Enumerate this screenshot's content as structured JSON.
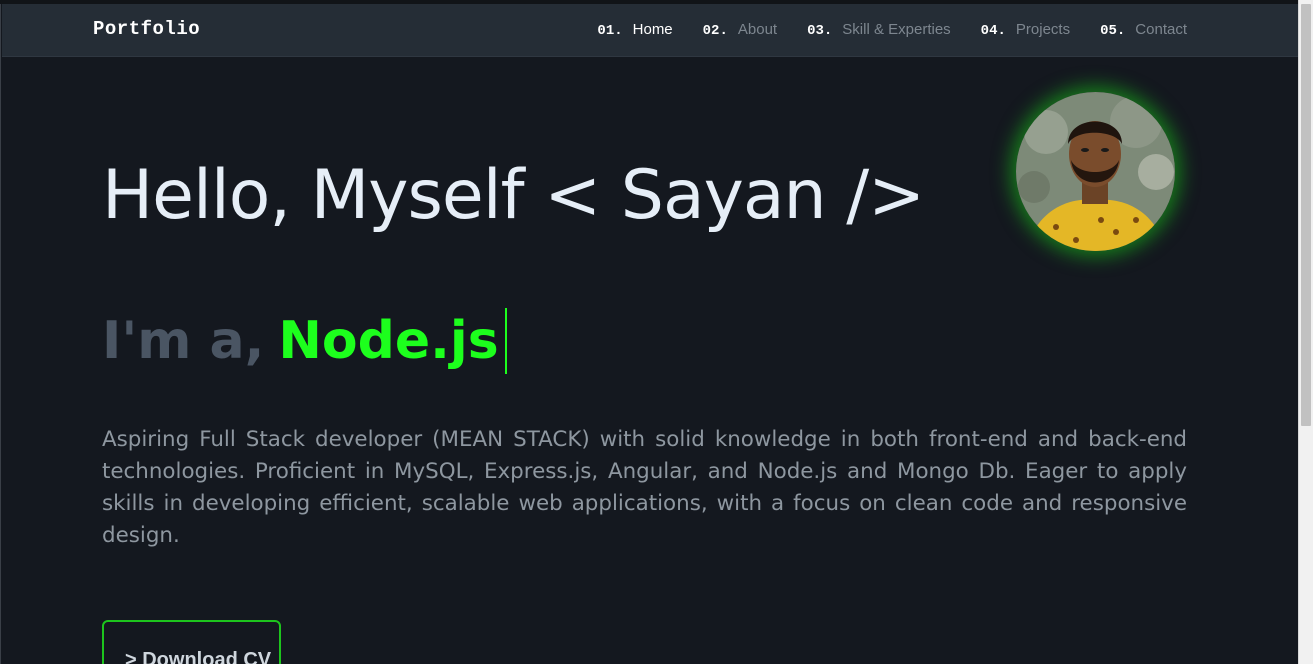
{
  "navbar": {
    "brand": "Portfolio",
    "items": [
      {
        "num": "01.",
        "label": "Home",
        "active": true
      },
      {
        "num": "02.",
        "label": "About",
        "active": false
      },
      {
        "num": "03.",
        "label": "Skill & Experties",
        "active": false
      },
      {
        "num": "04.",
        "label": "Projects",
        "active": false
      },
      {
        "num": "05.",
        "label": "Contact",
        "active": false
      }
    ]
  },
  "hero": {
    "greeting": "Hello, Myself < Sayan />",
    "role_prefix": "I'm a,",
    "role_typed": "Node.js",
    "bio": "Aspiring Full Stack developer (MEAN STACK) with solid knowledge in both front-end and back-end technologies. Proficient in MySQL, Express.js, Angular, and Node.js and Mongo Db. Eager to apply skills in developing efficient, scalable web applications, with a focus on clean code and responsive design.",
    "cv_button": "> Download CV"
  },
  "colors": {
    "background": "#14181f",
    "navbar": "#252d36",
    "accent_green": "#1dff1d",
    "heading": "#e6eef7",
    "muted": "#8e97a0"
  }
}
